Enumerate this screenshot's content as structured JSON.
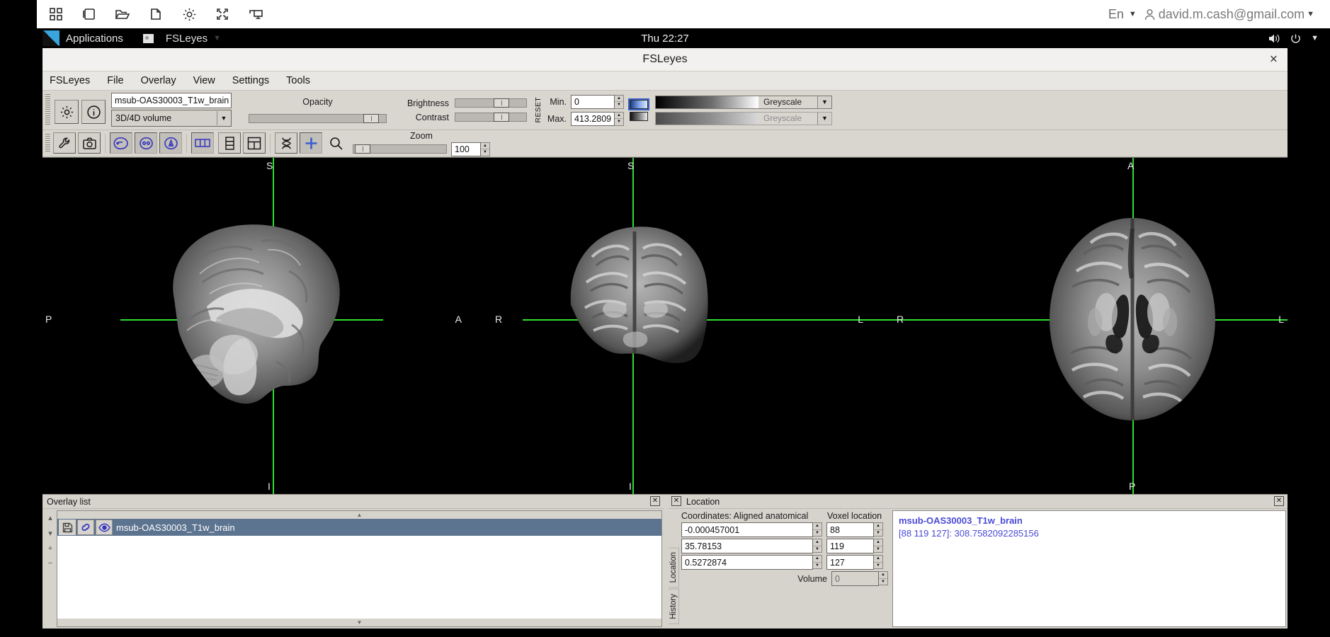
{
  "vm_chrome": {
    "icons": [
      "grid-icon",
      "window-icon",
      "folder-open-icon",
      "copy-icon",
      "gear-icon",
      "fullscreen-icon",
      "display-icon"
    ],
    "language": "En",
    "user_email": "david.m.cash@gmail.com"
  },
  "desktop_panel": {
    "applications_label": "Applications",
    "active_app": "FSLeyes",
    "clock": "Thu 22:27",
    "tray_icons": [
      "volume-icon",
      "power-icon",
      "chevron-down-icon"
    ]
  },
  "window": {
    "title": "FSLeyes",
    "close_label": "×"
  },
  "menubar": {
    "items": [
      "FSLeyes",
      "File",
      "Overlay",
      "View",
      "Settings",
      "Tools"
    ]
  },
  "display_toolbar": {
    "settings_icon": "gear-icon",
    "info_icon": "info-icon",
    "overlay_name": "msub-OAS30003_T1w_brain",
    "overlay_type": "3D/4D volume",
    "opacity_label": "Opacity",
    "brightness_label": "Brightness",
    "contrast_label": "Contrast",
    "reset_label": "RESET",
    "min_label": "Min.",
    "min_value": "0",
    "max_label": "Max.",
    "max_value": "413.2809",
    "colourmap_primary": "Greyscale",
    "colourmap_negative": "Greyscale"
  },
  "view_toolbar": {
    "tools": [
      {
        "name": "ortho-settings-icon",
        "glyph": "wrench"
      },
      {
        "name": "screenshot-icon",
        "glyph": "camera"
      },
      {
        "name": "toggle-sagittal-icon",
        "glyph": "brain-side"
      },
      {
        "name": "toggle-coronal-icon",
        "glyph": "brain-front"
      },
      {
        "name": "toggle-axial-icon",
        "glyph": "brain-top"
      },
      {
        "name": "layout-horizontal-icon",
        "glyph": "row"
      },
      {
        "name": "layout-vertical-icon",
        "glyph": "column"
      },
      {
        "name": "layout-grid-icon",
        "glyph": "grid"
      },
      {
        "name": "movie-mode-icon",
        "glyph": "dna"
      },
      {
        "name": "crosshair-toggle-icon",
        "glyph": "plus"
      },
      {
        "name": "zoom-icon",
        "glyph": "magnifier"
      }
    ],
    "zoom_label": "Zoom",
    "zoom_value": "100"
  },
  "canvas": {
    "panels": [
      {
        "name": "sagittal-view",
        "labels": {
          "top": "S",
          "bottom": "I",
          "left": "P",
          "right": "A"
        }
      },
      {
        "name": "coronal-view",
        "labels": {
          "top": "S",
          "bottom": "I",
          "left": "R",
          "right": "L"
        }
      },
      {
        "name": "axial-view",
        "labels": {
          "top": "A",
          "bottom": "P",
          "left": "R",
          "right": "L"
        }
      }
    ],
    "crosshair_color": "#2ee02e",
    "background_color": "#000000"
  },
  "overlay_panel": {
    "title": "Overlay list",
    "close_label": "✕",
    "side_buttons": [
      "▴",
      "▾",
      "+",
      "−"
    ],
    "rows": [
      {
        "save_icon": "save-icon",
        "link_icon": "link-icon",
        "visibility_icon": "eye-icon",
        "name": "msub-OAS30003_T1w_brain",
        "selected": true
      }
    ]
  },
  "location_panel": {
    "title": "Location",
    "close_label": "✕",
    "tabs": [
      "History",
      "Location"
    ],
    "coords_header": "Coordinates: Aligned anatomical",
    "voxel_header": "Voxel location",
    "coords": [
      "-0.000457001",
      "35.78153",
      "0.5272874"
    ],
    "voxels": [
      "88",
      "119",
      "127"
    ],
    "volume_label": "Volume",
    "volume_value": "0",
    "info_overlay_name": "msub-OAS30003_T1w_brain",
    "info_value_line": "[88 119 127]: 308.7582092285156",
    "info_color": "#4a4ad6"
  }
}
